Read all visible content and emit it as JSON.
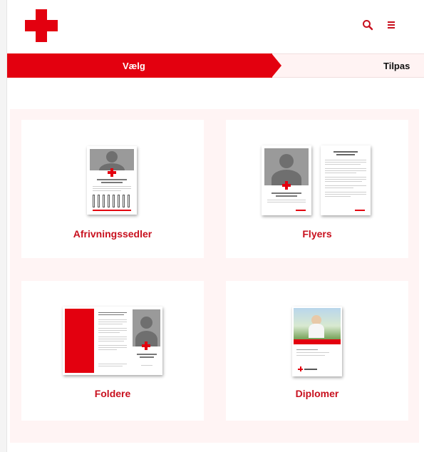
{
  "header": {
    "logo_icon": "red-cross-icon",
    "search_icon": "search-icon",
    "menu_icon": "hamburger-menu-icon"
  },
  "steps": [
    {
      "label": "Vælg",
      "active": true
    },
    {
      "label": "Tilpas",
      "active": false
    }
  ],
  "cards": [
    {
      "label": "Afrivningssedler"
    },
    {
      "label": "Flyers"
    },
    {
      "label": "Foldere"
    },
    {
      "label": "Diplomer"
    }
  ],
  "colors": {
    "brand_red": "#e3000f",
    "title_red": "#c8101e",
    "panel_background": "#fff4f4"
  }
}
